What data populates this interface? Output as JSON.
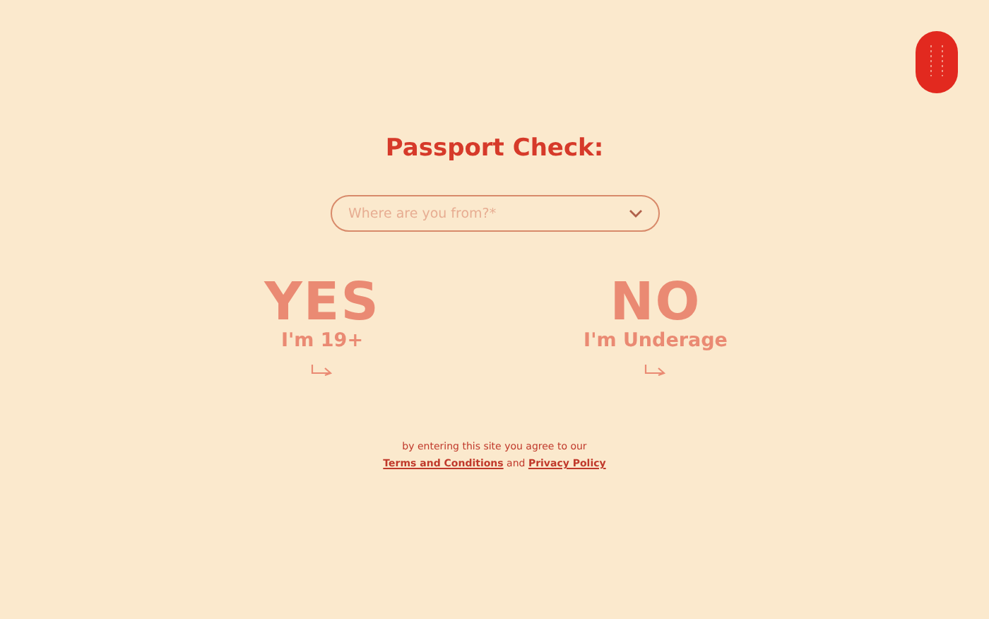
{
  "title": "Passport Check:",
  "country_select": {
    "placeholder": "Where are you from?*"
  },
  "options": [
    {
      "heading": "YES",
      "label": "I'm 19+"
    },
    {
      "heading": "NO",
      "label": "I'm Underage"
    }
  ],
  "legal": {
    "text": "by entering this site you agree to our",
    "terms_link": "Terms and Conditions",
    "conjunction": "and",
    "privacy_link": "Privacy Policy"
  }
}
